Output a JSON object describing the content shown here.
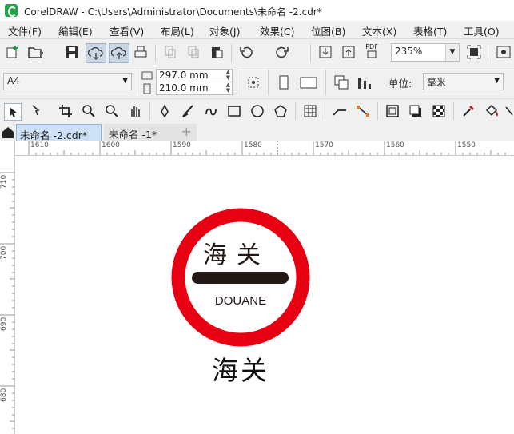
{
  "window": {
    "title": "CorelDRAW - C:\\Users\\Administrator\\Documents\\未命名 -2.cdr*"
  },
  "menu": [
    "文件(F)",
    "编辑(E)",
    "查看(V)",
    "布局(L)",
    "对象(J)",
    "效果(C)",
    "位图(B)",
    "文本(X)",
    "表格(T)",
    "工具(O)"
  ],
  "standard_toolbar": {
    "icons": [
      "new-icon",
      "open-icon",
      "save-icon",
      "cloud-download-icon",
      "cloud-upload-icon",
      "print-icon",
      "cut-icon",
      "copy-icon",
      "paste-icon",
      "undo-icon",
      "redo-icon",
      "import-icon",
      "export-icon",
      "pdf-icon",
      "full-screen-icon",
      "options-icon"
    ],
    "pdf_label": "PDF",
    "zoom": "235%"
  },
  "property_bar": {
    "page_size": "A4",
    "width": "297.0 mm",
    "height": "210.0 mm",
    "units_label": "单位:",
    "units_value": "毫米"
  },
  "tools": [
    "pick-tool-icon",
    "shape-tool-icon",
    "crop-tool-icon",
    "zoom-tool-icon",
    "zoom-out-icon",
    "pan-tool-icon",
    "pen-tool-icon",
    "brush-tool-icon",
    "curve-tool-icon",
    "rectangle-tool-icon",
    "ellipse-tool-icon",
    "polygon-tool-icon",
    "table-tool-icon",
    "connector-tool-icon",
    "dimension-tool-icon",
    "contour-icon",
    "drop-shadow-icon",
    "transparency-icon",
    "eyedropper-icon",
    "fill-icon"
  ],
  "tabs": [
    {
      "label": "未命名 -2.cdr*",
      "active": true
    },
    {
      "label": "未命名 -1*",
      "active": false
    }
  ],
  "ruler": {
    "top_labels": [
      "1610",
      "1600",
      "1590",
      "1580",
      "1570",
      "1560",
      "1550"
    ],
    "left_labels": [
      "710",
      "700",
      "690",
      "680"
    ]
  },
  "artwork": {
    "ring_color": "#e60012",
    "bar_color": "#231815",
    "sign_chinese": "海关",
    "sign_latin": "DOUANE",
    "caption": "海关"
  }
}
